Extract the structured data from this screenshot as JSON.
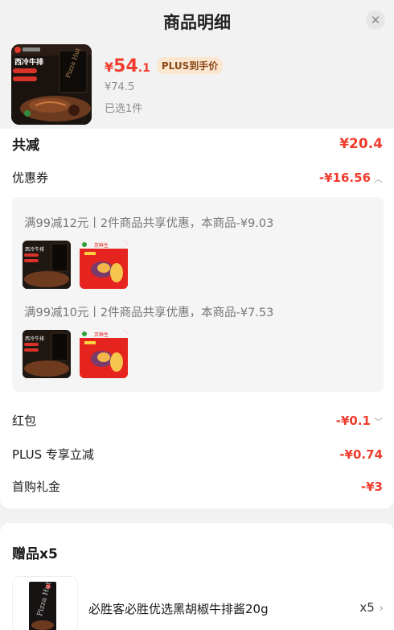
{
  "header": {
    "title": "商品明细",
    "close_icon": "close-icon"
  },
  "product": {
    "price_currency": "¥",
    "price_int": "54",
    "price_dec": ".1",
    "plus_tag": "PLUS到手价",
    "original_price": "¥74.5",
    "selected_text": "已选1件",
    "image_label": "西冷牛排"
  },
  "discounts": {
    "total_label": "共减",
    "total_value": "¥20.4",
    "coupon_label": "优惠券",
    "coupon_value": "-¥16.56",
    "coupons": [
      {
        "text": "满99减12元丨2件商品共享优惠，本商品-¥9.03"
      },
      {
        "text": "满99减10元丨2件商品共享优惠，本商品-¥7.53"
      }
    ],
    "thumb_steak_label": "西冷牛排",
    "thumb_potato_label": "京鲜生",
    "redpacket_label": "红包",
    "redpacket_value": "-¥0.1",
    "plus_label": "PLUS 专享立减",
    "plus_value": "-¥0.74",
    "firstbuy_label": "首购礼金",
    "firstbuy_value": "-¥3"
  },
  "gifts": {
    "title": "赠品x5",
    "item_name": "必胜客必胜优选黑胡椒牛排酱20g",
    "item_qty": "x5"
  },
  "colors": {
    "accent_red": "#f03c2e",
    "plus_bg": "#fbe6d0",
    "plus_text": "#8a4b1c"
  }
}
